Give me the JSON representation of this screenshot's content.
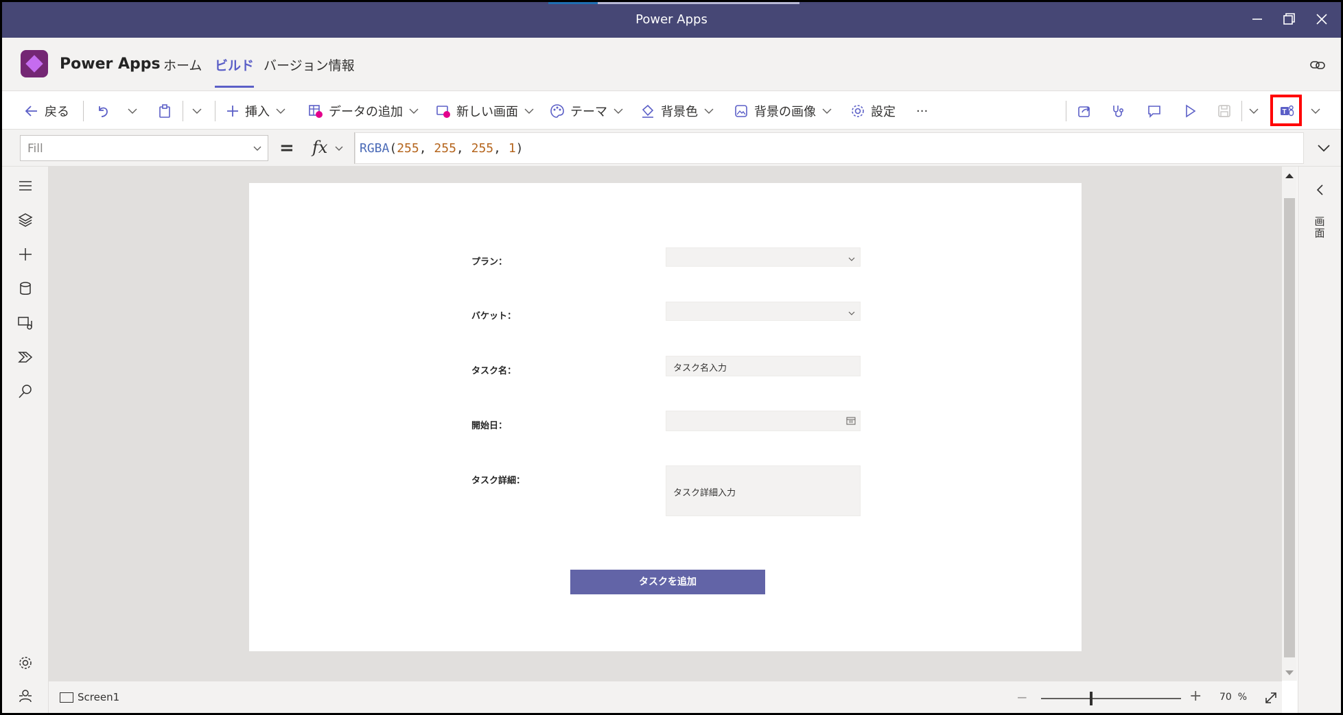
{
  "window": {
    "title": "Power Apps"
  },
  "app": {
    "name": "Power Apps",
    "tabs": [
      {
        "label": "ホーム",
        "active": false
      },
      {
        "label": "ビルド",
        "active": true
      },
      {
        "label": "バージョン情報",
        "active": false
      }
    ]
  },
  "toolbar": {
    "back_label": "戻る",
    "insert_label": "挿入",
    "add_data_label": "データの追加",
    "new_screen_label": "新しい画面",
    "theme_label": "テーマ",
    "bg_color_label": "背景色",
    "bg_image_label": "背景の画像",
    "settings_label": "設定",
    "more_label": "···"
  },
  "formula_bar": {
    "property": "Fill",
    "equals": "=",
    "fx_label": "fx",
    "formula": {
      "fn": "RGBA",
      "open": "(",
      "args": [
        "255",
        "255",
        "255",
        "1"
      ],
      "close": ")"
    }
  },
  "form": {
    "fields": [
      {
        "label": "プラン：",
        "type": "dropdown",
        "value": ""
      },
      {
        "label": "バケット：",
        "type": "dropdown",
        "value": ""
      },
      {
        "label": "タスク名：",
        "type": "text",
        "placeholder": "タスク名入力"
      },
      {
        "label": "開始日：",
        "type": "date",
        "value": ""
      },
      {
        "label": "タスク詳細：",
        "type": "multiline",
        "placeholder": "タスク詳細入力"
      }
    ],
    "submit_label": "タスクを追加"
  },
  "right_panel": {
    "label": "画面"
  },
  "status_bar": {
    "screen_name": "Screen1",
    "zoom_value": "70",
    "zoom_unit": "%"
  },
  "colors": {
    "title_bar": "#464775",
    "accent": "#5b5fc7",
    "submit_button": "#6264a7",
    "logo": "#742774",
    "highlight": "#ff0000"
  },
  "icons": {
    "left_rail": [
      "hamburger-icon",
      "layers-icon",
      "plus-icon",
      "database-icon",
      "media-icon",
      "power-automate-icon",
      "search-icon"
    ],
    "left_rail_bottom": [
      "gear-icon",
      "person-icon"
    ],
    "toolbar_right": [
      "share-icon",
      "stethoscope-icon",
      "comment-icon",
      "play-icon",
      "save-icon",
      "teams-icon"
    ]
  }
}
